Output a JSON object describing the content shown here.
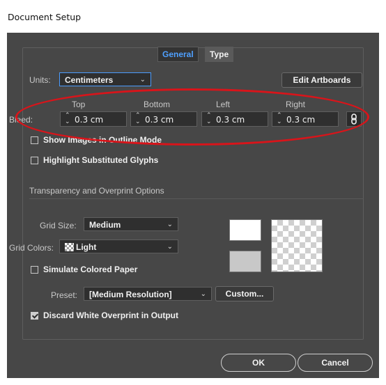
{
  "window": {
    "title": "Document Setup"
  },
  "tabs": [
    {
      "label": "General",
      "active": true
    },
    {
      "label": "Type",
      "active": false
    }
  ],
  "units": {
    "label": "Units:",
    "value": "Centimeters"
  },
  "edit_artboards_label": "Edit Artboards",
  "bleed": {
    "label": "Bleed:",
    "columns": {
      "top": "Top",
      "bottom": "Bottom",
      "left": "Left",
      "right": "Right"
    },
    "values": {
      "top": "0.3 cm",
      "bottom": "0.3 cm",
      "left": "0.3 cm",
      "right": "0.3 cm"
    }
  },
  "options": {
    "show_images_outline": {
      "label": "Show Images in Outline Mode",
      "checked": false
    },
    "highlight_glyphs": {
      "label": "Highlight Substituted Glyphs",
      "checked": false
    }
  },
  "transparency": {
    "section_title": "Transparency and Overprint Options",
    "grid_size": {
      "label": "Grid Size:",
      "value": "Medium"
    },
    "grid_colors": {
      "label": "Grid Colors:",
      "value": "Light"
    },
    "simulate_paper": {
      "label": "Simulate Colored Paper",
      "checked": false
    },
    "preset": {
      "label": "Preset:",
      "value": "[Medium Resolution]"
    },
    "custom_label": "Custom...",
    "discard_white": {
      "label": "Discard White Overprint in Output",
      "checked": true
    }
  },
  "footer": {
    "ok_label": "OK",
    "cancel_label": "Cancel"
  },
  "colors": {
    "dialog_bg": "#474747",
    "active_tab_text": "#4fa0ff",
    "highlight_ellipse": "#d9141a"
  },
  "icons": {
    "spinner": "updown-arrows-icon",
    "chevron": "chevron-down-icon",
    "link": "chain-link-icon"
  }
}
